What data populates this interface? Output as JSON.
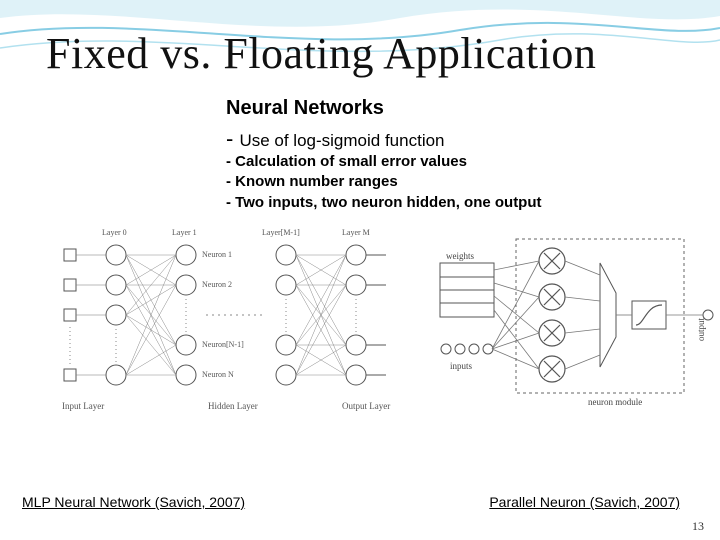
{
  "title": "Fixed vs. Floating Application",
  "subtitle": "Neural Networks",
  "bullets": [
    "Use of log-sigmoid function",
    "Calculation of small error values",
    "Known number ranges",
    "Two inputs, two neuron hidden, one output"
  ],
  "figure1": {
    "caption": "MLP Neural Network (Savich, 2007)",
    "labels": {
      "layer0": "Layer 0",
      "layer1": "Layer 1",
      "layerM1": "Layer[M-1]",
      "layerM": "Layer M",
      "neuron1": "Neuron 1",
      "neuron2": "Neuron 2",
      "neuronN1": "Neuron[N-1]",
      "neuronN": "Neuron N",
      "inputLayer": "Input Layer",
      "hiddenLayer": "Hidden Layer",
      "outputLayer": "Output Layer"
    }
  },
  "figure2": {
    "caption": "Parallel Neuron (Savich, 2007)",
    "labels": {
      "weights": "weights",
      "inputs": "inputs",
      "neuronModule": "neuron module",
      "output": "output"
    }
  },
  "pageNumber": "13"
}
